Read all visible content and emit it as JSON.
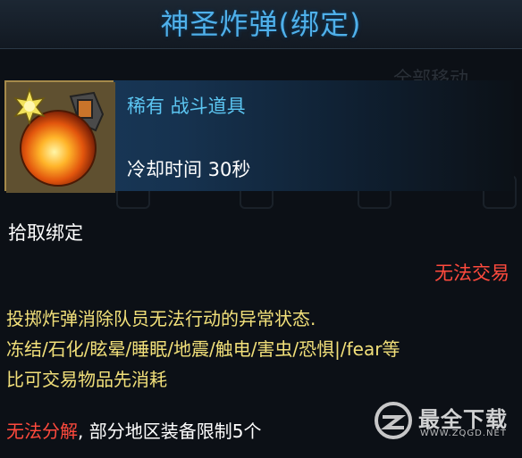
{
  "title": "神圣炸弹(绑定)",
  "background_text": "全部移动",
  "item": {
    "rarity": "稀有 战斗道具",
    "cooldown": "冷却时间 30秒",
    "icon": "grenade-icon"
  },
  "bind": "拾取绑定",
  "trade_status": "无法交易",
  "description": [
    "投掷炸弹消除队员无法行动的异常状态.",
    "冻结/石化/眩晕/睡眠/地震/触电/害虫/恐惧|/fear等",
    "比可交易物品先消耗"
  ],
  "footer": {
    "warning": "无法分解",
    "rest": ", 部分地区装备限制5个"
  },
  "watermark": {
    "title": "最全下载",
    "subtitle": "WWW.ZQGD.NET"
  },
  "colors": {
    "title": "#4fb0ea",
    "rarity": "#5cc6f2",
    "warning": "#ff4a3d",
    "description": "#f2e07a"
  }
}
